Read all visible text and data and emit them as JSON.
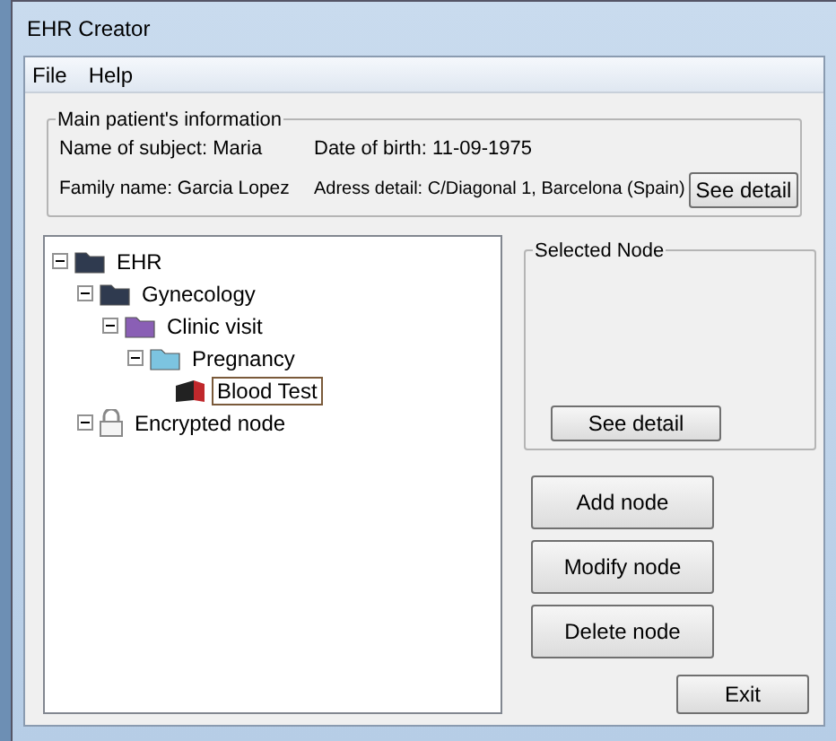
{
  "window": {
    "title": "EHR Creator"
  },
  "menu": [
    {
      "label": "File"
    },
    {
      "label": "Help"
    }
  ],
  "patient": {
    "title": "Main patient's information",
    "name": "Name of subject: Maria",
    "birth": "Date of birth: 11-09-1975",
    "family": "Family name: Garcia Lopez",
    "address": "Adress detail: C/Diagonal 1, Barcelona (Spain)",
    "button": "See detail"
  },
  "tree": [
    {
      "label": "EHR",
      "kind": "folder",
      "color": "#2f3a4f",
      "expanded": true,
      "selected": false,
      "children": [
        {
          "label": "Gynecology",
          "kind": "folder",
          "color": "#2f3a4f",
          "expanded": true,
          "selected": false,
          "children": [
            {
              "label": "Clinic visit",
              "kind": "folder",
              "color": "#8a5fb5",
              "expanded": true,
              "selected": false,
              "children": [
                {
                  "label": "Pregnancy",
                  "kind": "folder",
                  "color": "#7cc4e0",
                  "expanded": true,
                  "selected": false,
                  "children": [
                    {
                      "label": "Blood Test",
                      "kind": "record",
                      "selected": true
                    }
                  ]
                }
              ]
            }
          ]
        },
        {
          "label": "Encrypted node",
          "kind": "lock",
          "expanded": true,
          "selected": false
        }
      ]
    }
  ],
  "selected_node": {
    "title": "Selected Node",
    "button": "See detail"
  },
  "actions": [
    "Add node",
    "Modify node",
    "Delete node"
  ],
  "exit": "Exit"
}
